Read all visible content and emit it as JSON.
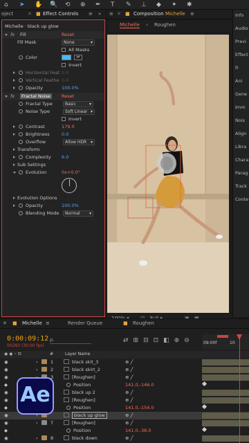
{
  "toolbar": {
    "icons": [
      "home-icon",
      "select-arrow-icon",
      "hand-icon",
      "zoom-icon",
      "orbit-icon",
      "pan-behind-icon",
      "pen-icon",
      "text-icon",
      "brush-icon",
      "stamp-icon",
      "eraser-icon",
      "puppet-icon",
      "pin-icon"
    ]
  },
  "effect_controls": {
    "tab_project": "oject",
    "tab_title": "Effect Controls",
    "breadcrumb": "Michelle · black up glow",
    "fill": {
      "name": "Fill",
      "reset": "Reset",
      "fill_mask_label": "Fill Mask",
      "fill_mask_value": "None",
      "all_masks_label": "All Masks",
      "color_label": "Color",
      "invert_label": "Invert",
      "hfeather_label": "Horizontal Feat",
      "hfeather_value": "0.0",
      "vfeather_label": "Vertical Feathe",
      "vfeather_value": "0.0",
      "opacity_label": "Opacity",
      "opacity_value": "100.0%",
      "color_hex": "#4ab8ff"
    },
    "fractal": {
      "name": "Fractal Noise",
      "reset": "Reset",
      "fractal_type_label": "Fractal Type",
      "fractal_type_value": "Basic",
      "noise_type_label": "Noise Type",
      "noise_type_value": "Soft Linear",
      "invert_label": "Invert",
      "contrast_label": "Contrast",
      "contrast_value": "179.0",
      "brightness_label": "Brightness",
      "brightness_value": "0.0",
      "overflow_label": "Overflow",
      "overflow_value": "Allow HDR",
      "transform_label": "Transform",
      "complexity_label": "Complexity",
      "complexity_value": "6.0",
      "sub_settings_label": "Sub Settings",
      "evolution_label": "Evolution",
      "evolution_value": "0x+0.0°",
      "evolution_options_label": "Evolution Options",
      "opacity_label": "Opacity",
      "opacity_value": "100.0%",
      "blending_label": "Blending Mode",
      "blending_value": "Normal"
    }
  },
  "composition": {
    "tab_title": "Composition",
    "tab_name": "Michelle",
    "crumb_active": "Michelle",
    "crumb_next": "Roughen",
    "zoom": "100%",
    "resolution": "Full"
  },
  "right_panel": {
    "items": [
      "Info",
      "Audio",
      "Previ",
      "Effect",
      "fr",
      "Ani",
      "Gene",
      "Imm",
      "Nois",
      "Align",
      "Libra",
      "Chara",
      "Parag",
      "Track",
      "Conte"
    ]
  },
  "timeline": {
    "tab_comp": "Michelle",
    "tab_render": "Render Queue",
    "tab_roughen": "Roughen",
    "timecode": "0:00:09:12",
    "frames": "00283 (30.00 fps)",
    "search_placeholder": "ρ.",
    "col_hash": "#",
    "col_layer": "Layer Name",
    "ruler_start": "09:00f",
    "ruler_mid": "10",
    "logo": "Ae",
    "rows": [
      {
        "num": "1",
        "name": "black skit_3",
        "color": "#a88a5a"
      },
      {
        "num": "2",
        "name": "black skirt_2",
        "color": "#a88a5a"
      },
      {
        "num": "3",
        "name": "[Roughen]",
        "color": "#8a8a8a"
      },
      {
        "num": "",
        "name": "Position",
        "value": "141.0,-146.0",
        "prop": true
      },
      {
        "num": "",
        "name": "black up 2",
        "color": "#a88a5a"
      },
      {
        "num": "",
        "name": "[Roughen]",
        "color": "#8a8a8a"
      },
      {
        "num": "",
        "name": "Position",
        "value": "141.0,-154.0",
        "prop": true
      },
      {
        "num": "",
        "name": "black up glow",
        "color": "#a88a5a",
        "selected": true
      },
      {
        "num": "7",
        "name": "[Roughen]",
        "color": "#8a8a8a"
      },
      {
        "num": "",
        "name": "Position",
        "value": "141.0,-38.0",
        "prop": true
      },
      {
        "num": "8",
        "name": "black down",
        "color": "#a88a5a"
      }
    ]
  }
}
